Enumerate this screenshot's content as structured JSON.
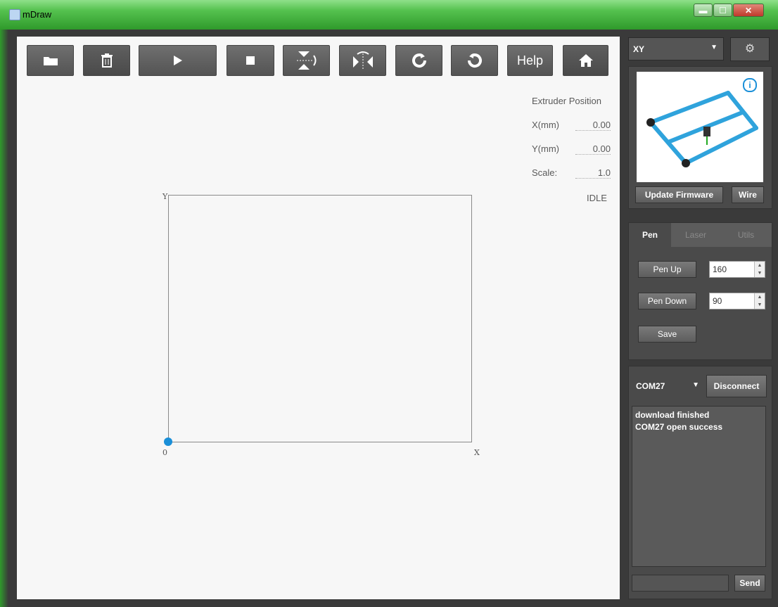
{
  "window": {
    "title": "mDraw",
    "controls": [
      "minimize",
      "maximize",
      "close"
    ]
  },
  "toolbar": {
    "buttons": [
      {
        "name": "open-folder",
        "icon": "folder-icon"
      },
      {
        "name": "clear",
        "icon": "trash-icon"
      },
      {
        "name": "play",
        "icon": "play-icon"
      },
      {
        "name": "stop",
        "icon": "stop-icon"
      },
      {
        "name": "flip-vertical",
        "icon": "flip-vertical-icon"
      },
      {
        "name": "flip-horizontal",
        "icon": "flip-horizontal-icon"
      },
      {
        "name": "rotate-cw",
        "icon": "rotate-cw-icon"
      },
      {
        "name": "rotate-ccw",
        "icon": "rotate-ccw-icon"
      },
      {
        "name": "help",
        "label": "Help"
      },
      {
        "name": "home",
        "icon": "home-icon"
      }
    ]
  },
  "extruder": {
    "title": "Extruder Position",
    "x_label": "X(mm)",
    "x_value": "0.00",
    "y_label": "Y(mm)",
    "y_value": "0.00",
    "scale_label": "Scale:",
    "scale_value": "1.0",
    "status": "IDLE"
  },
  "plot": {
    "y_axis": "Y",
    "x_axis": "X",
    "origin": "0"
  },
  "right": {
    "machine_select": "XY",
    "buttons": {
      "update_firmware": "Update Firmware",
      "wire": "Wire"
    },
    "tabs": [
      "Pen",
      "Laser",
      "Utils"
    ],
    "pen": {
      "pen_up_label": "Pen Up",
      "pen_up_value": "160",
      "pen_down_label": "Pen Down",
      "pen_down_value": "90",
      "save_label": "Save"
    },
    "connection": {
      "port": "COM27",
      "disconnect_label": "Disconnect",
      "log": [
        "download finished",
        "COM27 open success"
      ],
      "send_label": "Send"
    }
  },
  "colors": {
    "accent": "#1a8fd8",
    "titlebar": "#55c24f",
    "panel": "#4a4a4a",
    "canvas": "#f7f7f7",
    "log_green": "#2e8b2e"
  }
}
